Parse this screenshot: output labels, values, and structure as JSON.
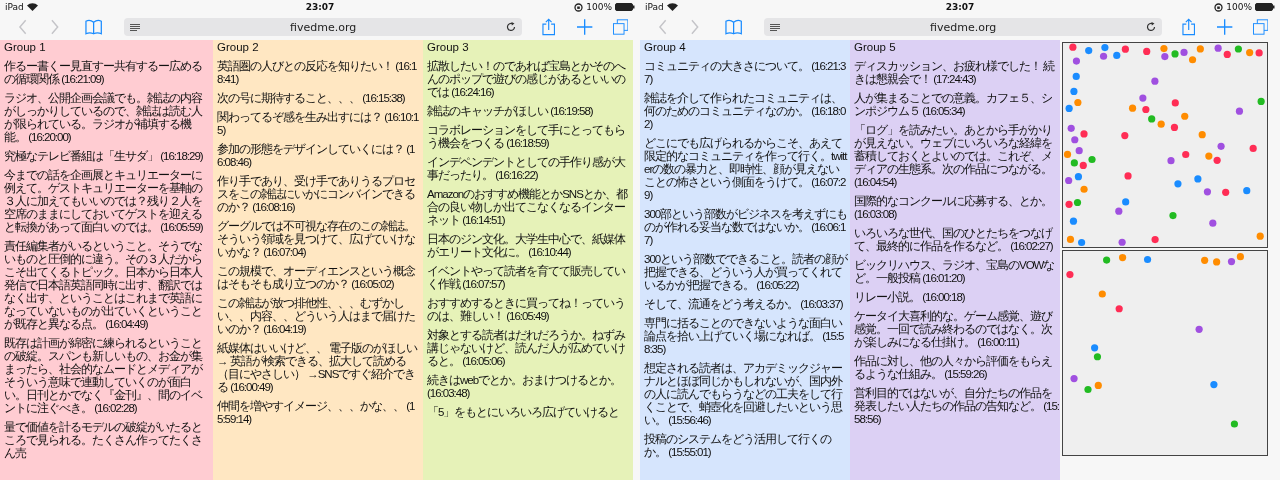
{
  "screens": [
    {
      "kind": "groups",
      "status_bar": {
        "device": "iPad",
        "time": "23:07",
        "battery": "100%"
      },
      "toolbar": {
        "url": "fivedme.org"
      },
      "groups": [
        {
          "title": "Group 1",
          "color": "#ffccd2",
          "comments": [
            "作るー書くー見直すー共有するー広めるの循環関係 (16:21:09)",
            "ラジオ、公開企画会議でも。雑誌の内容がしっかりしているので、雑誌は読む人が限られている。ラジオが補填する機能。 (16:20:00)",
            "究極なテレビ番組は「生サダ」 (16:18:29)",
            "今までの話を企画展とキュリエーターに例えて。ゲストキュリエーターを基軸の３人に加えてもいいのでは？残り２人を空席のままにしておいてゲストを迎えると転換があって面白いのでは。 (16:05:59)",
            "責任編集者がいるということ。そうでないものと圧倒的に違う。その３人だからこそ出てくるトピック。日本から日本人発信で日本語英語同時に出す、翻訳ではなく出す、ということはこれまで英語になっていないものが出ていくということが既存と異なる点。 (16:04:49)",
            "既存は計画が綿密に練られるということの破綻。スパンも新しいもの、お金が集まったら、社会的なムードとメディアがそういう意味で連動していくのが面白い。日刊とかでなく『金刊』、間のイベントに注ぐべき。 (16:02:28)",
            "量で価値を計るモデルの破綻がいたるところで見られる。たくさん作ってたくさん売"
          ]
        },
        {
          "title": "Group 2",
          "color": "#ffe7c2",
          "comments": [
            "英語圏の人びとの反応を知りたい！ (16:18:41)",
            "次の号に期待すること、、、 (16:15:38)",
            "関わってるぞ感を生み出すには？ (16:10:15)",
            "参加の形態をデザインしていくには？ (16:08:46)",
            "作り手であり、受け手でありうるプロセスをこの雑誌にいかにコンバインできるのか？ (16:08:16)",
            "グーグルでは不可視な存在のこの雑誌。そういう領域を見つけて、広げていけないかな？ (16:07:04)",
            "この規模で、オーディエンスという概念はそもそも成り立つのか？ (16:05:02)",
            "この雑誌が放つ排他性、、、むずかしい、、内容、、どういう人はまで届けたいのか？ (16:04:19)",
            "紙媒体はいいけど、、 電子版のがほしい → 英語が検索できる、拡大して読める（目にやさしい） →SNSですぐ紹介できる (16:00:49)",
            "仲間を増やすイメージ、、、かな、、 (15:59:14)"
          ]
        },
        {
          "title": "Group 3",
          "color": "#e6f2b8",
          "comments": [
            "拡散したい！のであれば宝島とかそのへんのポップで遊びの感じがあるといいのでは (16:24:16)",
            "雑誌のキャッチがほしい (16:19:58)",
            "コラボレーションをして手にとってもらう機会をつくる (16:18:59)",
            "インデペンデントとしての手作り感が大事だったり。 (16:16:22)",
            "Amazonのおすすめ機能とかSNSとか、都合の良い物しか出てこなくなるインターネット (16:14:51)",
            "日本のジン文化。大学生中心で、紙媒体がエリート文化に。 (16:10:44)",
            "イベントやって読者を育てて販売していく作戦 (16:07:57)",
            "おすすめするときに買ってね！っていうのは、難しい！ (16:05:49)",
            "対象とする読者はだれだろうか。ねずみ講じゃないけど、読んだ人が広めていけると。 (16:05:06)",
            "続きはwebでとか。おまけつけるとか。 (16:03:48)",
            "「5」をもとにいろいろ広げていけると"
          ]
        }
      ]
    },
    {
      "kind": "groups-with-plots",
      "status_bar": {
        "device": "iPad",
        "time": "23:07",
        "battery": "100%"
      },
      "toolbar": {
        "url": "fivedme.org"
      },
      "groups": [
        {
          "title": "Group 4",
          "color": "#d6e5fd",
          "comments": [
            "コミュニティの大きさについて。 (16:21:37)",
            "雑誌を介して作られたコミュニティは、何のためのコミュニティなのか。 (16:18:02)",
            "どこにでも広げられるからこそ、あえて限定的なコミュニティを作って行く。twitterの数の暴力と、即時性、顔が見えないことの怖さという側面をうけて。 (16:07:29)",
            "300部という部数がビジネスを考えずにものが作れる妥当な数ではないか。 (16:06:17)",
            "300という部数でできること。読者の顔が把握できる、どういう人が買ってくれているかが把握できる。 (16:05:22)",
            "そして、流通をどう考えるか。 (16:03:37)",
            "専門に括ることのできないような面白い論点を拾い上げていく場になれば。 (15:58:35)",
            "想定される読者は、アカデミックジャーナルとほぼ同じかもしれないが、国内外の人に読んでもらうなどの工夫をして行くことで、蛸壺化を回避したいという思い。 (15:56:46)",
            "投稿のシステムをどう活用して行くのか。 (15:55:01)"
          ]
        },
        {
          "title": "Group 5",
          "color": "#dcd0f4",
          "comments": [
            "ディスカッション、お疲れ様でした！ 続きは懇親会で！ (17:24:43)",
            "人が集まることでの意義。カフェ５、シンポジウム５ (16:05:34)",
            "「ログ」を読みたい。あとから手がかりが見えない。ウェブにいろいろな経緯を蓄積しておくとよいのでは。これぞ、メディアの生態系。次の作品につながる。 (16:04:54)",
            "国際的なコンクールに応募する、とか。 (16:03:08)",
            "いろいろな世代、国のひとたちをつなげて、最終的に作品を作るなど。 (16:02:27)",
            "ビックリハウス、ラジオ、宝島のVOWなど。一般投稿 (16:01:20)",
            "リレー小説。 (16:00:18)",
            "ケータイ大喜利的な。ゲーム感覚、遊び感覚。一回で読み終わるのではなく。次が楽しみになる仕掛け。 (16:00:11)",
            "作品に対し、他の人々から評価をもらえるような仕組み。 (15:59:26)",
            "営利目的ではないが、自分たちの作品を発表したい人たちの作品の告知など。 (15:58:56)"
          ]
        }
      ]
    }
  ]
}
